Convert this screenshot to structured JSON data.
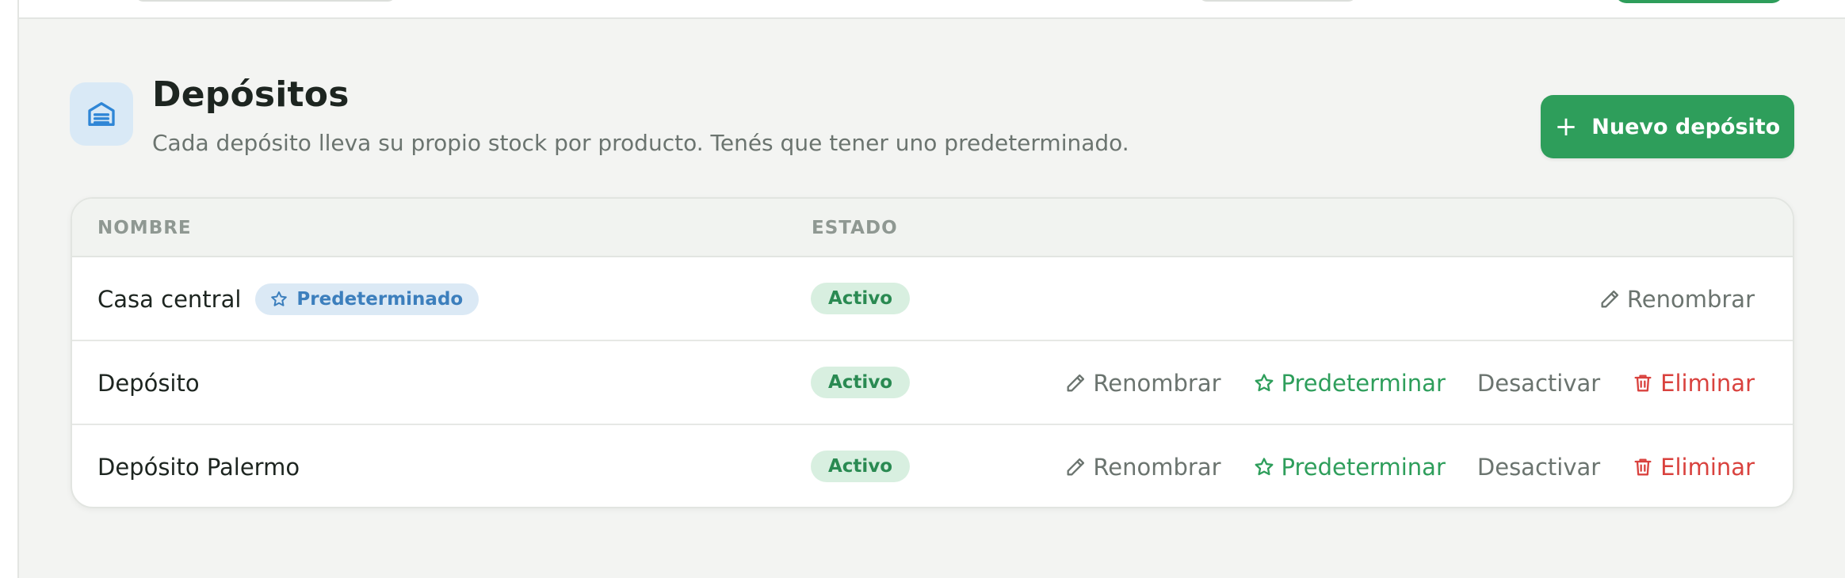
{
  "page": {
    "title": "Depósitos",
    "subtitle": "Cada depósito lleva su propio stock por producto. Tenés que tener uno predeterminado.",
    "icon": "warehouse-icon",
    "new_button_label": "Nuevo depósito"
  },
  "table": {
    "columns": {
      "name": "NOMBRE",
      "status": "ESTADO"
    },
    "rows": [
      {
        "name": "Casa central",
        "default_badge": "Predeterminado",
        "status": "Activo",
        "actions": {
          "rename": "Renombrar"
        }
      },
      {
        "name": "Depósito",
        "status": "Activo",
        "actions": {
          "rename": "Renombrar",
          "set_default": "Predeterminar",
          "deactivate": "Desactivar",
          "delete": "Eliminar"
        }
      },
      {
        "name": "Depósito Palermo",
        "status": "Activo",
        "actions": {
          "rename": "Renombrar",
          "set_default": "Predeterminar",
          "deactivate": "Desactivar",
          "delete": "Eliminar"
        }
      }
    ]
  },
  "colors": {
    "primary_green": "#2e9e5b",
    "danger_red": "#d9423e",
    "info_blue": "#3c7fbd",
    "background": "#f3f4f2"
  }
}
